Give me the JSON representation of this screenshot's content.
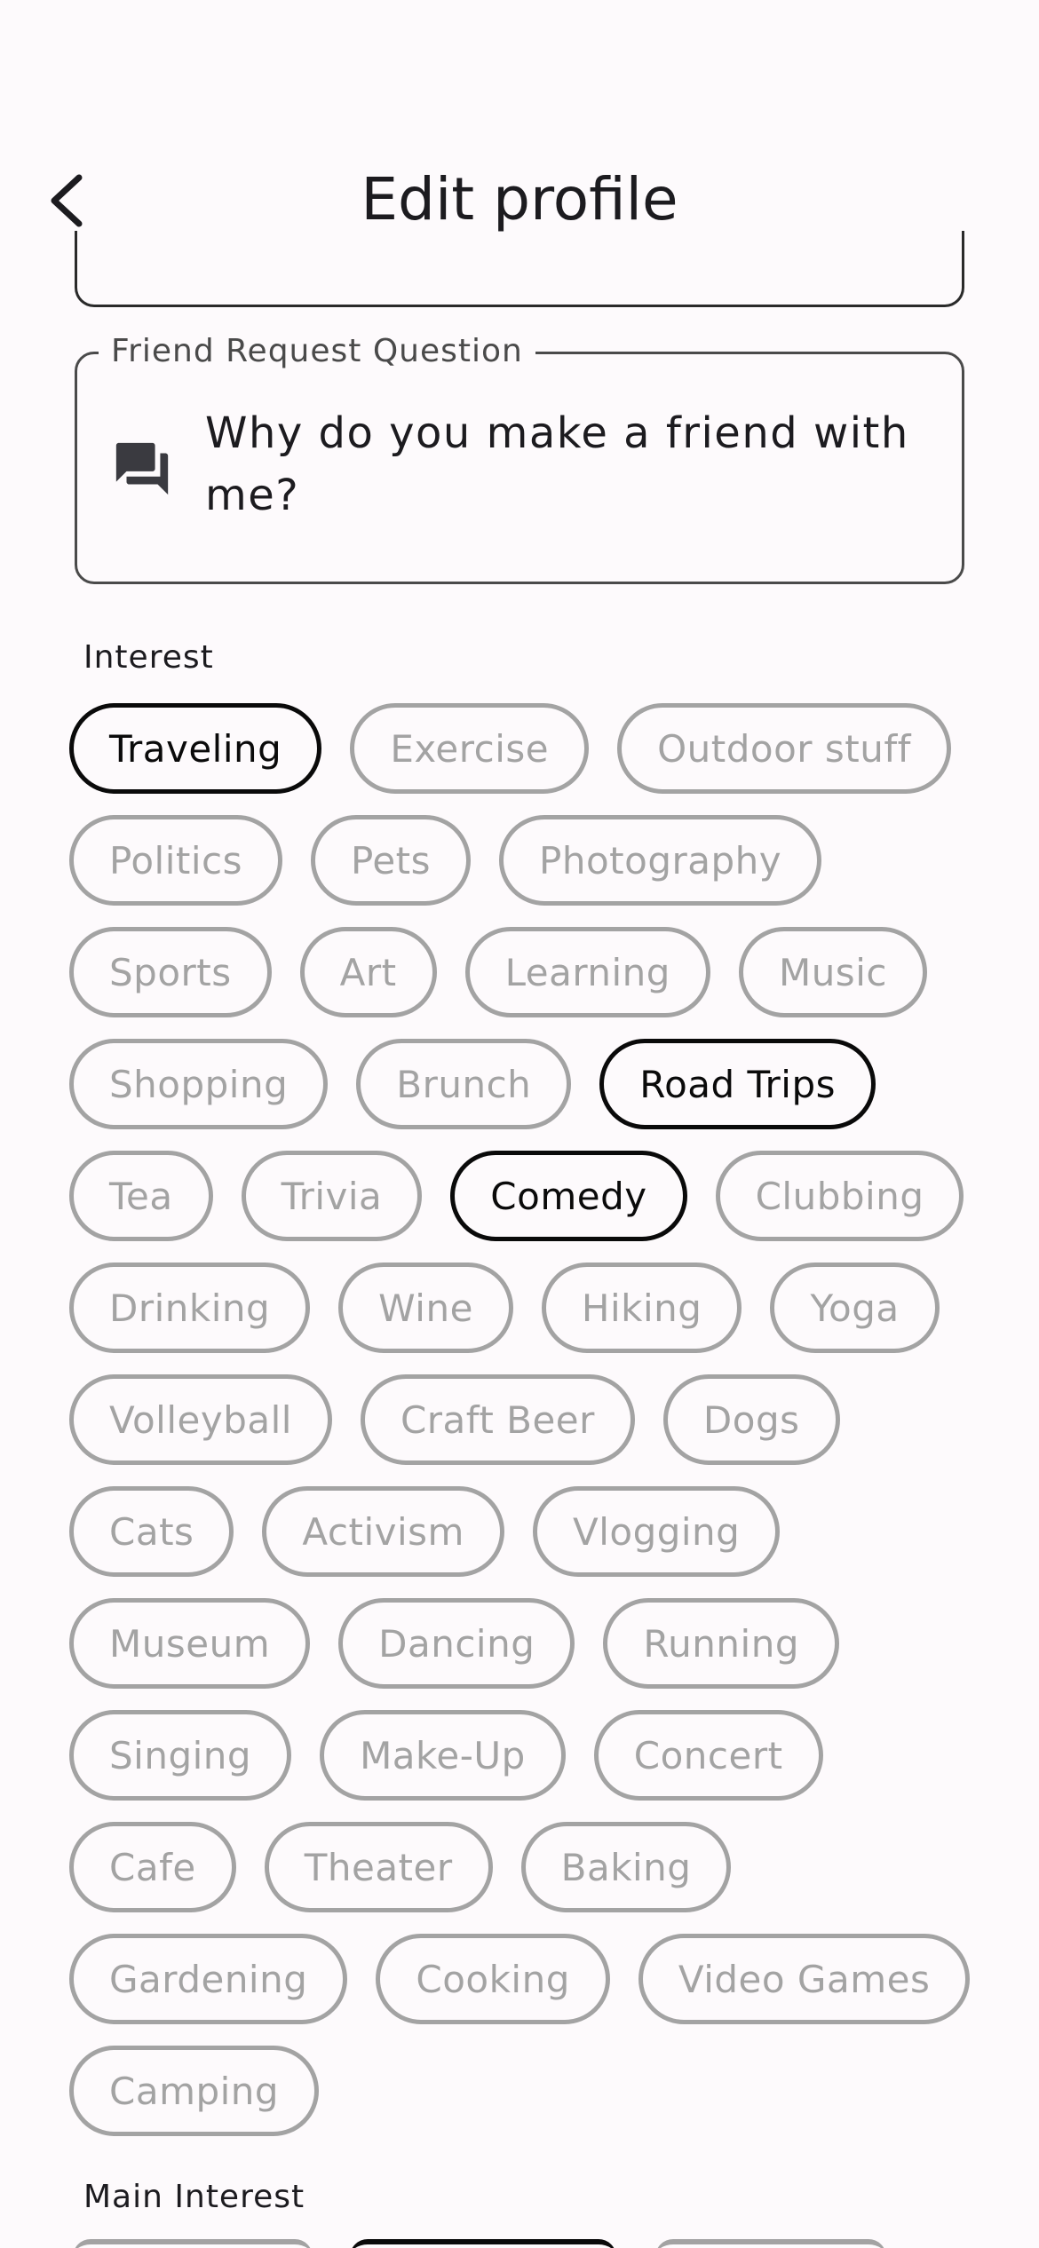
{
  "header": {
    "title": "Edit profile"
  },
  "friend_request": {
    "label": "Friend Request Question",
    "value": "Why do you make a friend with me?",
    "icon": "forum-icon"
  },
  "interest": {
    "label": "Interest",
    "rows": [
      [
        {
          "label": "Traveling",
          "selected": true
        },
        {
          "label": "Exercise",
          "selected": false
        },
        {
          "label": "Outdoor stuff",
          "selected": false
        }
      ],
      [
        {
          "label": "Politics",
          "selected": false
        },
        {
          "label": "Pets",
          "selected": false
        },
        {
          "label": "Photography",
          "selected": false
        }
      ],
      [
        {
          "label": "Sports",
          "selected": false
        },
        {
          "label": "Art",
          "selected": false
        },
        {
          "label": "Learning",
          "selected": false
        },
        {
          "label": "Music",
          "selected": false
        }
      ],
      [
        {
          "label": "Shopping",
          "selected": false
        },
        {
          "label": "Brunch",
          "selected": false
        },
        {
          "label": "Road Trips",
          "selected": true
        }
      ],
      [
        {
          "label": "Tea",
          "selected": false
        },
        {
          "label": "Trivia",
          "selected": false
        },
        {
          "label": "Comedy",
          "selected": true
        },
        {
          "label": "Clubbing",
          "selected": false
        }
      ],
      [
        {
          "label": "Drinking",
          "selected": false
        },
        {
          "label": "Wine",
          "selected": false
        },
        {
          "label": "Hiking",
          "selected": false
        },
        {
          "label": "Yoga",
          "selected": false
        }
      ],
      [
        {
          "label": "Volleyball",
          "selected": false
        },
        {
          "label": "Craft Beer",
          "selected": false
        },
        {
          "label": "Dogs",
          "selected": false
        }
      ],
      [
        {
          "label": "Cats",
          "selected": false
        },
        {
          "label": "Activism",
          "selected": false
        },
        {
          "label": "Vlogging",
          "selected": false
        }
      ],
      [
        {
          "label": "Museum",
          "selected": false
        },
        {
          "label": "Dancing",
          "selected": false
        },
        {
          "label": "Running",
          "selected": false
        }
      ],
      [
        {
          "label": "Singing",
          "selected": false
        },
        {
          "label": "Make-Up",
          "selected": false
        },
        {
          "label": "Concert",
          "selected": false
        }
      ],
      [
        {
          "label": "Cafe",
          "selected": false
        },
        {
          "label": "Theater",
          "selected": false
        },
        {
          "label": "Baking",
          "selected": false
        }
      ],
      [
        {
          "label": "Gardening",
          "selected": false
        },
        {
          "label": "Cooking",
          "selected": false
        },
        {
          "label": "Video Games",
          "selected": false
        }
      ],
      [
        {
          "label": "Camping",
          "selected": false
        }
      ]
    ]
  },
  "main_interest": {
    "label": "Main Interest"
  }
}
